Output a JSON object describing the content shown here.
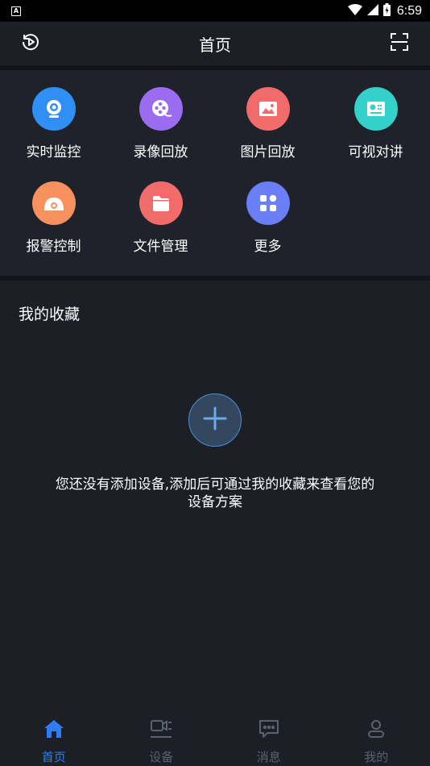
{
  "status_bar": {
    "time": "6:59",
    "app_icon_letter": "A"
  },
  "header": {
    "title": "首页",
    "left_icon": "playback-icon",
    "right_icon": "scan-icon"
  },
  "grid": {
    "items": [
      {
        "label": "实时监控",
        "icon": "camera-icon",
        "color": "#2f8ff5"
      },
      {
        "label": "录像回放",
        "icon": "film-reel-icon",
        "color": "#9b6cf0"
      },
      {
        "label": "图片回放",
        "icon": "picture-icon",
        "color": "#f26b6b"
      },
      {
        "label": "可视对讲",
        "icon": "intercom-icon",
        "color": "#33d1c9"
      },
      {
        "label": "报警控制",
        "icon": "alarm-icon",
        "color": "#f7925f"
      },
      {
        "label": "文件管理",
        "icon": "folder-icon",
        "color": "#f26b6b"
      },
      {
        "label": "更多",
        "icon": "more-apps-icon",
        "color": "#6a7ef5"
      }
    ]
  },
  "favorites": {
    "title": "我的收藏",
    "empty_line1": "您还没有添加设备,添加后可通过我的收藏来查看您的",
    "empty_line2": "设备方案"
  },
  "bottom_nav": {
    "items": [
      {
        "label": "首页",
        "icon": "home-icon",
        "active": true
      },
      {
        "label": "设备",
        "icon": "device-icon",
        "active": false
      },
      {
        "label": "消息",
        "icon": "message-icon",
        "active": false
      },
      {
        "label": "我的",
        "icon": "profile-icon",
        "active": false
      }
    ],
    "active_color": "#2f7cf6",
    "inactive_color": "#5a6170"
  }
}
